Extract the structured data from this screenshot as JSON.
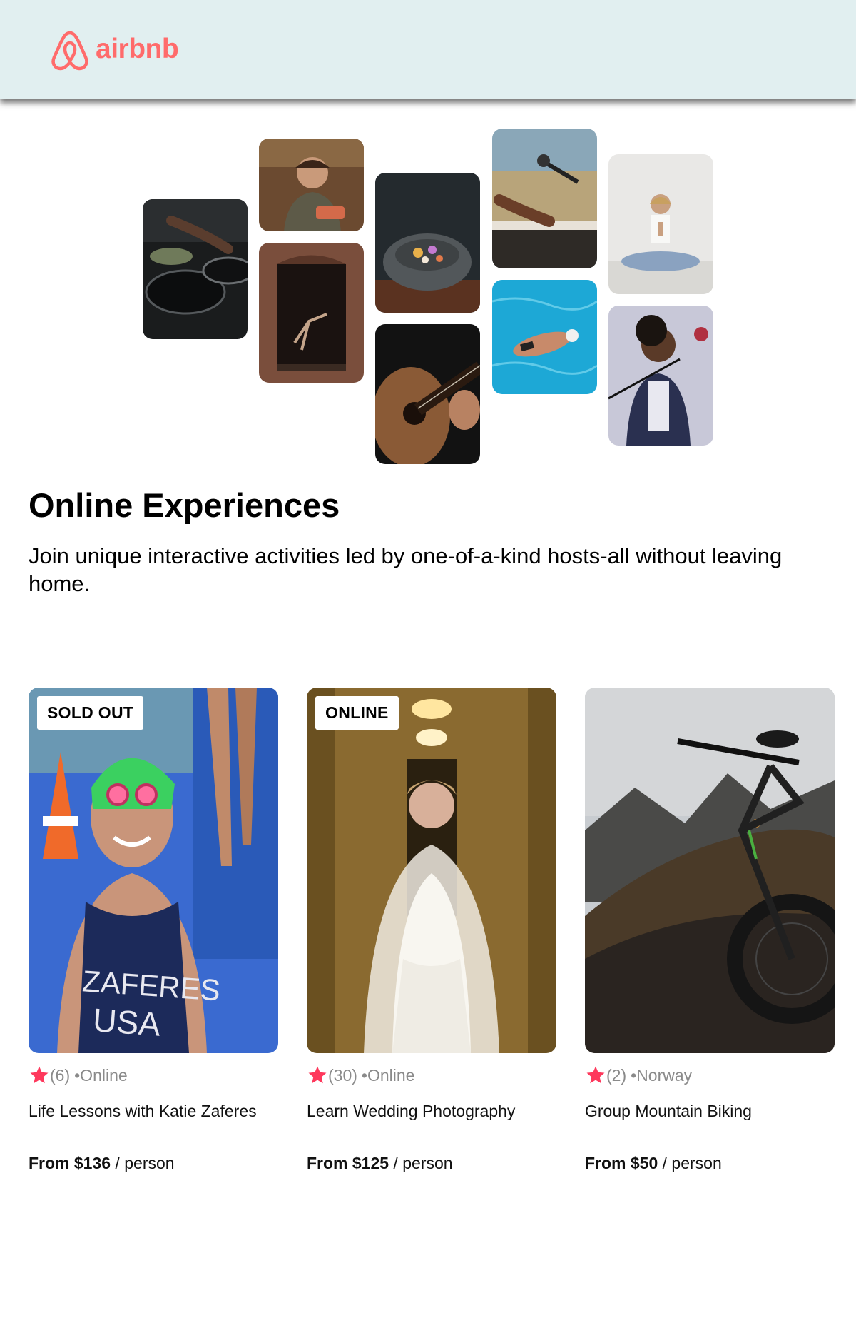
{
  "brand": {
    "name": "airbnb",
    "color": "#ff6b6b"
  },
  "hero": {
    "title": "Online Experiences",
    "subtitle": "Join unique interactive activities led by one-of-a-kind hosts-all without leaving home."
  },
  "cards": [
    {
      "badge": "SOLD OUT",
      "rating_count": "(6)",
      "location": "•Online",
      "title": "Life Lessons with Katie Zaferes",
      "price_prefix": "From $136",
      "price_suffix": "/ person",
      "image_caption_lines": [
        "ZAFERES",
        "USA"
      ]
    },
    {
      "badge": "ONLINE",
      "rating_count": "(30)",
      "location": "•Online",
      "title": "Learn Wedding Photography",
      "price_prefix": "From $125",
      "price_suffix": "/ person"
    },
    {
      "badge": "",
      "rating_count": "(2)",
      "location": "•Norway",
      "title": "Group Mountain Biking",
      "price_prefix": "From $50",
      "price_suffix": "/ person"
    }
  ],
  "colors": {
    "nav_bg": "#e1eff0",
    "star": "#fe385c",
    "muted": "#8a8a8a"
  },
  "icons": {
    "logo": "airbnb-belo-icon",
    "rating": "star-icon"
  }
}
